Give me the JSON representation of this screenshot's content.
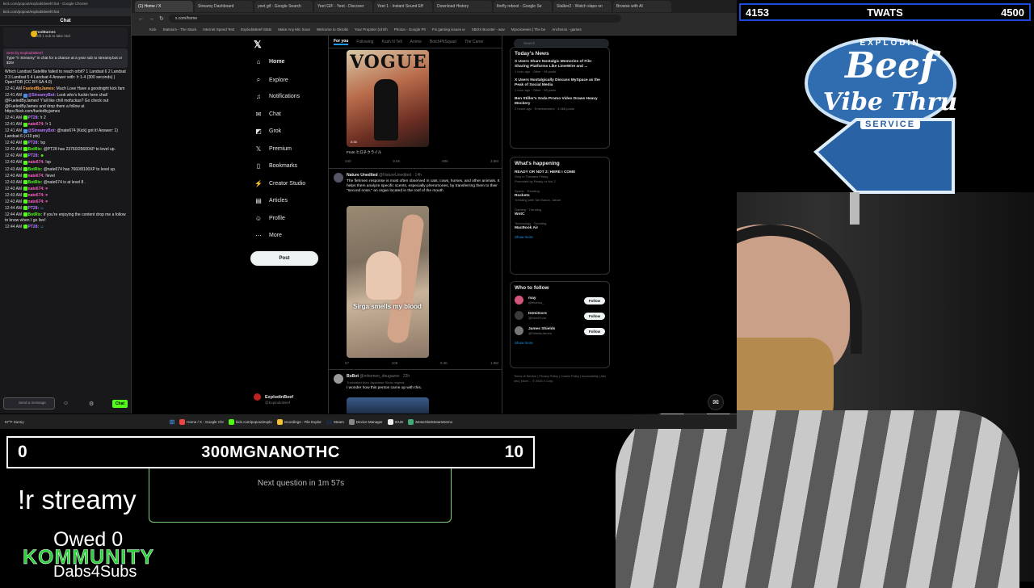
{
  "chat": {
    "url": "kick.com/popout/explodinbeef/chat - Google Chrome",
    "url2": "kick.com/popout/explodinbeef/chat",
    "title": "Chat",
    "pin_user": "FoolBarnes",
    "pin_text": "Gift 1 sub to take 2nd",
    "sub_by": "Sent by ExplodinBeef",
    "sub_text": "Type \"!r Streamy\" in chat for a chance at a year sub to streamy.bot or $25!",
    "messages": [
      {
        "ts": "",
        "user": "",
        "text": "Which Landsat Satellite failed to reach orbit? 1 Landsat 6 2 Landsat 3 3 Landsat 5 4 Landsat 4 Answer with: !r 1-4 (300 seconds) | OpenTDB (CC BY-SA 4.0)"
      },
      {
        "ts": "12:41 AM",
        "user": "FueledByJames:",
        "text": "Much Love Have a goodnight kick fam"
      },
      {
        "ts": "12:41 AM",
        "user": "@StreamyBot:",
        "text": "Look who's fuckin here chat! @FueledByJames! Y'all like chill mofuckas? Go check out @FueledByJames and drop them a follow at https://kick.com/fueledbyjames"
      },
      {
        "ts": "12:41 AM",
        "user": "PT28:",
        "text": "!r 2"
      },
      {
        "ts": "12:41 AM",
        "user": "nate674:",
        "text": "!r 1"
      },
      {
        "ts": "12:41 AM",
        "user": "@StreamyBot:",
        "text": "@nate674 [Kick] got it! Answer: 1) Landsat 6 (+10 pts)"
      },
      {
        "ts": "12:42 AM",
        "user": "PT28:",
        "text": "!xp"
      },
      {
        "ts": "12:42 AM",
        "user": "BotRix:",
        "text": "@PT28 has 23760/25600XP to level up."
      },
      {
        "ts": "12:42 AM",
        "user": "PT28:",
        "text": ""
      },
      {
        "ts": "12:43 AM",
        "user": "nate674:",
        "text": "!xp"
      },
      {
        "ts": "12:43 AM",
        "user": "BotRix:",
        "text": "@nate674 has 7660/8100XP to level up."
      },
      {
        "ts": "12:43 AM",
        "user": "nate674:",
        "text": "!level"
      },
      {
        "ts": "12:43 AM",
        "user": "BotRix:",
        "text": "@nate674 is at level 8 ."
      },
      {
        "ts": "12:43 AM",
        "user": "nate674:",
        "text": ""
      },
      {
        "ts": "12:43 AM",
        "user": "nate674:",
        "text": ""
      },
      {
        "ts": "12:43 AM",
        "user": "nate674:",
        "text": ""
      },
      {
        "ts": "12:44 AM",
        "user": "PT28:",
        "text": ""
      },
      {
        "ts": "12:44 AM",
        "user": "BotRix:",
        "text": "If you're enjoying the content drop me a follow to know when I go live!"
      },
      {
        "ts": "12:44 AM",
        "user": "PT28:",
        "text": ""
      }
    ],
    "input_placeholder": "Send a message",
    "send_label": "Chat"
  },
  "browser": {
    "tabs": [
      "(1) Home / X",
      "Streamy Dashboard",
      "yeet gif - Google Search",
      "Yeet GIF - Yeet - Discover",
      "Yeet 1 - Instant Sound Eff",
      "Download History",
      "firefly reboot - Google Se",
      "Stalker2 - Watch slaps on",
      "Browse with AI"
    ],
    "url": "x.com/home",
    "bookmarks": [
      "Kick",
      "Statsium - The Stack",
      "Internet Speed Test",
      "ExplodinBeef Stats",
      "Make Any Mic Soun",
      "Welcome to Okrolis",
      "Your Propster (rd Eh",
      "Photos - Google Ph",
      "Fix gaming issues w",
      "XBOX Booster - wav",
      "Myvoiceeeis | The be",
      "Ancheros - games"
    ]
  },
  "x": {
    "nav": [
      "Home",
      "Explore",
      "Notifications",
      "Chat",
      "Grok",
      "Premium",
      "Bookmarks",
      "Creator Studio",
      "Articles",
      "Profile",
      "More"
    ],
    "post_label": "Post",
    "profile_name": "ExplodinBeef",
    "profile_handle": "@ExplodinBeef",
    "feed_tabs": [
      "For you",
      "Following",
      "Kush N Tell",
      "Anime",
      "BotchPitSquad",
      "The Came"
    ],
    "vogue_title": "VOGUE",
    "vogue_duration": "0:34",
    "vogue_caption": "From ヒロチクライル",
    "t1_actions": [
      "340",
      "9.6K",
      "80K",
      "3.8M"
    ],
    "t2_name": "Nature Unedited",
    "t2_handle": "@NatureUnedited · 14h",
    "t2_text": "The flehmen response is most often observed in cats, cows, horses, and other animals. It helps them analyze specific scents, especially pheromones, by transferring them to their \"second nose,\" an organ located in the roof of the mouth",
    "sirga_text": "Sirga smells my blood",
    "t2_actions": [
      "67",
      "108",
      "9.3K",
      "1.8M"
    ],
    "t3_name": "BoBot",
    "t3_handle": "@mhomeo_dougazev · 22h",
    "t3_trans": "Translated from Japanese Show original",
    "t3_text": "I wonder how this person came up with this.",
    "search_placeholder": "Search",
    "news_title": "Today's News",
    "news": [
      {
        "title": "X Users Share Nostalgic Memories of File-Sharing Platforms Like LimeWire and ...",
        "meta": "1 hour ago · Other · 95 posts"
      },
      {
        "title": "X Users Nostalgically Discuss MySpace as the Peak of Social Media",
        "meta": "1 hour ago · Other · 58 posts"
      },
      {
        "title": "Ben Stiller's Soda Promo Video Draws Heavy Mockery",
        "meta": "2 hours ago · Entertainment · 3,066 posts"
      }
    ],
    "happening_title": "What's happening",
    "trends": [
      {
        "top": "READY OR NOT 2: HERE I COME",
        "sub": "Only in Theaters Friday",
        "extra": "Promoted by Ready or Not 2"
      },
      {
        "top": "Sports · Trending",
        "sub": "Rockets",
        "extra": "Trending with Tari Eason, Jabari"
      },
      {
        "top": "Gaming · Trending",
        "sub": "WotC",
        "extra": ""
      },
      {
        "top": "Technology · Trending",
        "sub": "MacBook Air",
        "extra": ""
      }
    ],
    "show_more": "Show more",
    "wtf_title": "Who to follow",
    "follow_label": "Follow",
    "wtf": [
      {
        "name": "may",
        "handle": "@etcetca_"
      },
      {
        "name": "DemiGore",
        "handle": "@DemiGore"
      },
      {
        "name": "James Shields",
        "handle": "@ShieldsJames"
      }
    ],
    "footer": "Terms of Service | Privacy Policy | Cookie Policy | Accessibility | Ads info | More ... © 2026 X Corp."
  },
  "taskbar": {
    "weather": "57°F Sunny",
    "items": [
      "Home / X - Google Chr",
      "kick.com/popout/explo",
      "recordings - File Explor",
      "Steam",
      "Device Manager",
      "ICUE",
      "MotorSlotStreamDemo"
    ]
  },
  "overlay": {
    "top_left_score": "4153",
    "top_label": "TWATS",
    "top_right_score": "4500",
    "logo_line1": "EXPLODIN",
    "logo_line2": "Beef",
    "logo_line3": "Vibe Thru",
    "logo_line4": "SERVICE",
    "bottom_left_score": "0",
    "bottom_label": "300MGNANOTHC",
    "bottom_right_score": "10",
    "next_question": "Next question in 1m 57s",
    "streamy": "!r streamy",
    "owed": "Owed 0",
    "kommunity": "KOMMUNITY",
    "dabs": "Dabs4Subs"
  }
}
